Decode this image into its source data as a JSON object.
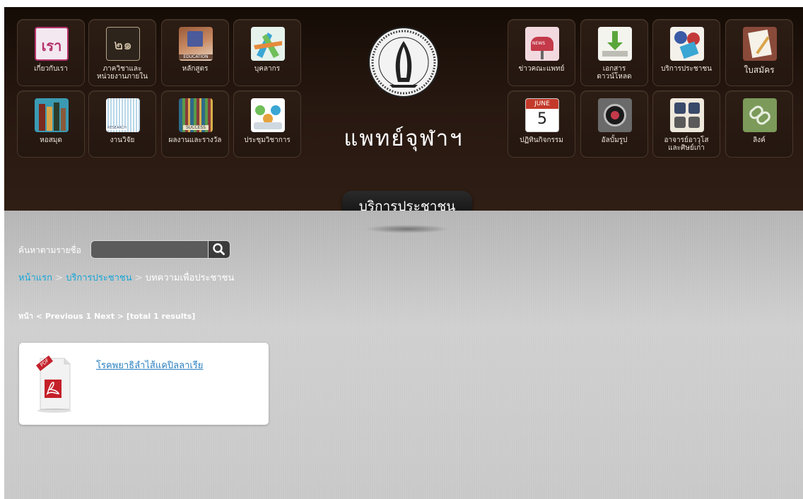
{
  "menu_left": [
    {
      "label": "เกี่ยวกับเรา",
      "icon": "about-us-icon",
      "icon_text": "เรา"
    },
    {
      "label": "ภาควิชาและ\nหน่วยงานภายใน",
      "icon": "departments-icon",
      "icon_text": "๒๑"
    },
    {
      "label": "หลักสูตร",
      "icon": "curriculum-icon",
      "icon_text": "EDUCATION"
    },
    {
      "label": "บุคลากร",
      "icon": "personnel-icon"
    },
    {
      "label": "หอสมุด",
      "icon": "library-icon"
    },
    {
      "label": "งานวิจัย",
      "icon": "research-icon",
      "icon_text": "RESEARCH"
    },
    {
      "label": "ผลงานและรางวัล",
      "icon": "awards-icon",
      "icon_text": "SUCCESS"
    },
    {
      "label": "ประชุมวิชาการ",
      "icon": "conference-icon"
    }
  ],
  "menu_right": [
    {
      "label": "ข่าวคณะแพทย์",
      "icon": "news-mailbox-icon",
      "icon_text": "NEWS"
    },
    {
      "label": "เอกสาร\nดาวน์โหลด",
      "icon": "download-icon"
    },
    {
      "label": "บริการประชาชน",
      "icon": "public-service-icon"
    },
    {
      "label": "ใบสมัคร",
      "icon": "application-form-icon"
    },
    {
      "label": "ปฏิทินกิจกรรม",
      "icon": "calendar-icon",
      "icon_month": "JUNE",
      "icon_day": "5"
    },
    {
      "label": "อัลบั้มรูป",
      "icon": "camera-lens-icon"
    },
    {
      "label": "อาจารย์อาวุโส\nและศิษย์เก่า",
      "icon": "alumni-icon"
    },
    {
      "label": "ลิงค์",
      "icon": "link-icon"
    }
  ],
  "site": {
    "title": "แพทย์จุฬาฯ",
    "logo_icon": "faculty-seal-logo"
  },
  "section": {
    "title": "บริการประชาชน"
  },
  "search": {
    "label": "ค้นหาตามรายชื่อ",
    "value": "",
    "placeholder": ""
  },
  "breadcrumb": {
    "home": "หน้าแรก",
    "sep": ">",
    "parent": "บริการประชาชน",
    "current": "บทความเพื่อประชาชน"
  },
  "pager": {
    "text": "หน้า < Previous 1 Next > [total 1 results]"
  },
  "results": [
    {
      "title": "โรคพยาธิลำไส้แคปิลลาเรีย",
      "icon": "pdf-file-icon",
      "icon_text": "PDF"
    }
  ],
  "colors": {
    "header_bg": "#261710",
    "content_bg": "#c4c4c4",
    "link": "#18a6d8",
    "result_link": "#2a7fc0"
  }
}
